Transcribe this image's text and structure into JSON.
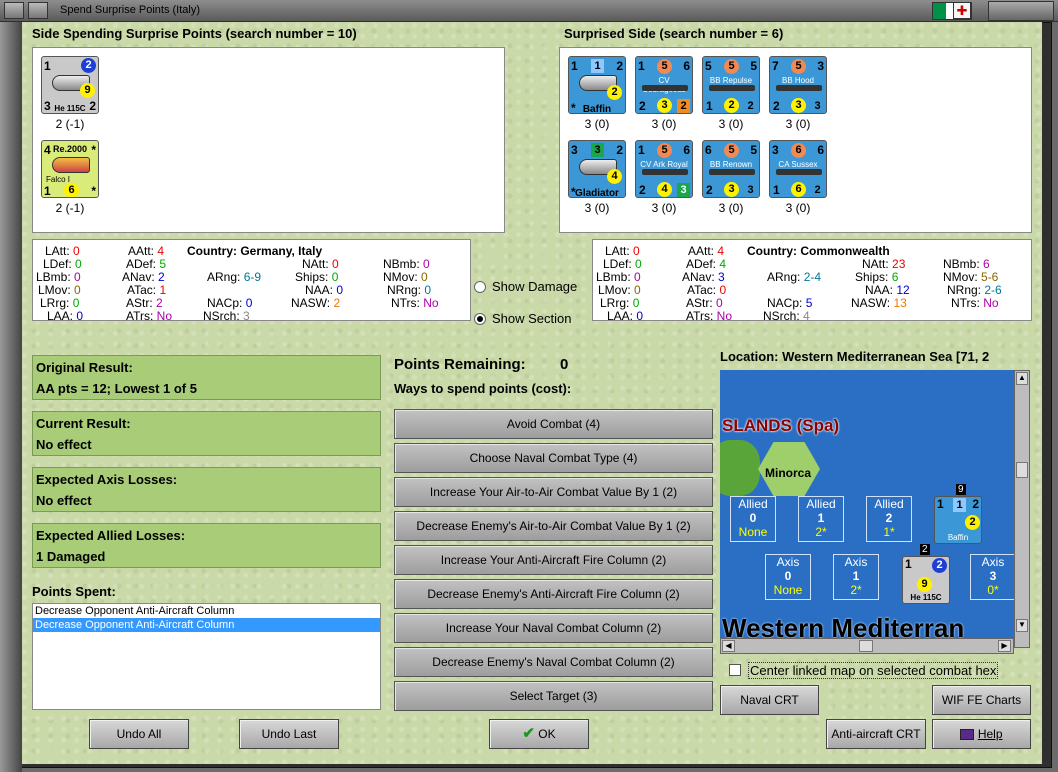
{
  "window": {
    "title": "Spend Surprise Points (Italy)"
  },
  "colors": {
    "flag_green": "#009246",
    "flag_white": "#ffffff",
    "flag_red": "#ce2b37",
    "panel_bg": "#cad9a8",
    "result_bg": "#a8cc78",
    "counter_blue": "#3b97d6",
    "sea": "#2a6fc4"
  },
  "spending": {
    "header": "Side Spending Surprise Points (search number = 10)",
    "units": [
      {
        "tl": "1",
        "tr": "2",
        "bl": "3",
        "br": "2",
        "mid": "9",
        "name": "He 115C",
        "caption": "2 (-1)",
        "icon": "seaplane-icon"
      },
      {
        "tl": "4",
        "tr": "*",
        "bl": "1",
        "bm": "6",
        "br": "*",
        "name_top": "Re.2000",
        "name": "Falco I",
        "caption": "2 (-1)",
        "icon": "fighter-icon"
      }
    ]
  },
  "surprised": {
    "header": "Surprised Side (search number = 6)",
    "units": [
      {
        "tl": "1",
        "tm": "1",
        "tr": "2",
        "mid": "2",
        "name": "Baffin",
        "bl": "*",
        "caption": "3 (0)"
      },
      {
        "tl": "1",
        "tm": "5",
        "tr": "6",
        "name": "CV Courageous",
        "bl": "2",
        "bm": "3",
        "br": "2",
        "caption": "3 (0)"
      },
      {
        "tl": "5",
        "tm": "5",
        "tr": "5",
        "name": "BB Repulse",
        "bl": "1",
        "bm": "2",
        "br": "2",
        "caption": "3 (0)"
      },
      {
        "tl": "7",
        "tm": "5",
        "tr": "3",
        "name": "BB Hood",
        "bl": "2",
        "bm": "3",
        "br": "3",
        "caption": "3 (0)"
      },
      {
        "tl": "3",
        "tm": "3",
        "tr": "2",
        "mid": "4",
        "name": "Gladiator",
        "bl": "*",
        "caption": "3 (0)"
      },
      {
        "tl": "1",
        "tm": "5",
        "tr": "6",
        "name": "CV Ark Royal",
        "bl": "2",
        "bm": "4",
        "br": "3",
        "caption": "3 (0)"
      },
      {
        "tl": "6",
        "tm": "5",
        "tr": "5",
        "name": "BB Renown",
        "bl": "2",
        "bm": "3",
        "br": "3",
        "caption": "3 (0)"
      },
      {
        "tl": "3",
        "tm": "6",
        "tr": "6",
        "name": "CA Sussex",
        "bl": "1",
        "bm": "6",
        "br": "2",
        "caption": "3 (0)"
      }
    ]
  },
  "axis_stats": {
    "country_label": "Country:",
    "country": "Germany, Italy",
    "LAtt": "0",
    "LDef": "0",
    "LBmb": "0",
    "LMov": "0",
    "LRrg": "0",
    "LAA": "0",
    "AAtt": "4",
    "ADef": "5",
    "ANav": "2",
    "ATac": "1",
    "AStr": "2",
    "ATrs": "No",
    "ARng": "6-9",
    "NACp": "0",
    "NSrch": "3",
    "NAtt": "0",
    "Ships": "0",
    "NAA": "0",
    "NASW": "2",
    "NBmb": "0",
    "NMov": "0",
    "NRng": "0",
    "NTrs": "No"
  },
  "allied_stats": {
    "country_label": "Country:",
    "country": "Commonwealth",
    "LAtt": "0",
    "LDef": "0",
    "LBmb": "0",
    "LMov": "0",
    "LRrg": "0",
    "LAA": "0",
    "AAtt": "4",
    "ADef": "4",
    "ANav": "3",
    "ATac": "0",
    "AStr": "0",
    "ATrs": "No",
    "ARng": "2-4",
    "NACp": "5",
    "NSrch": "4",
    "NAtt": "23",
    "Ships": "6",
    "NAA": "12",
    "NASW": "13",
    "NBmb": "6",
    "NMov": "5-6",
    "NRng": "2-6",
    "NTrs": "No"
  },
  "show": {
    "damage": "Show Damage",
    "section": "Show Section",
    "selected": "section"
  },
  "results": [
    {
      "title": "Original Result:",
      "value": "AA pts = 12; Lowest 1 of 5"
    },
    {
      "title": "Current Result:",
      "value": "No effect"
    },
    {
      "title": "Expected Axis Losses:",
      "value": "No effect"
    },
    {
      "title": "Expected Allied Losses:",
      "value": "1 Damaged"
    }
  ],
  "points_spent": {
    "label": "Points Spent:",
    "items": [
      "Decrease Opponent Anti-Aircraft Column",
      "Decrease Opponent Anti-Aircraft Column"
    ],
    "selected_index": 1
  },
  "remaining": {
    "label": "Points Remaining:",
    "value": "0",
    "ways": "Ways to spend points (cost):"
  },
  "actions": [
    "Avoid Combat (4)",
    "Choose Naval Combat Type (4)",
    "Increase Your Air-to-Air Combat Value By 1 (2)",
    "Decrease Enemy's Air-to-Air Combat Value By 1 (2)",
    "Increase Your Anti-Aircraft Fire Column (2)",
    "Decrease Enemy's Anti-Aircraft Fire Column (2)",
    "Increase Your Naval Combat Column (2)",
    "Decrease Enemy's Naval Combat Column (2)",
    "Select Target (3)"
  ],
  "location": {
    "label": "Location: Western Mediterranean Sea [71, 2"
  },
  "map": {
    "islands_label": "SLANDS (Spa)",
    "minorca": "Minorca",
    "sea_label": "Western Mediterran",
    "allied_boxes": [
      {
        "t": "Allied",
        "n": "0",
        "v": "None"
      },
      {
        "t": "Allied",
        "n": "1",
        "v": "2*"
      },
      {
        "t": "Allied",
        "n": "2",
        "v": "1*"
      }
    ],
    "axis_boxes": [
      {
        "t": "Axis",
        "n": "0",
        "v": "None"
      },
      {
        "t": "Axis",
        "n": "1",
        "v": "2*"
      },
      {
        "t": "Axis",
        "n": "3",
        "v": "0*"
      }
    ],
    "stack_allied": "9",
    "stack_axis": "2",
    "allied_counter": {
      "tl": "1",
      "tm": "1",
      "tr": "2",
      "mid": "2",
      "name": "Baffin"
    },
    "axis_counter": {
      "tl": "1",
      "tr": "2",
      "mid": "9",
      "name": "He 115C"
    }
  },
  "center_checkbox": "Center linked map on selected combat hex",
  "buttons": {
    "undo_all": "Undo All",
    "undo_last": "Undo Last",
    "ok": "OK",
    "naval_crt": "Naval CRT",
    "wif_fe_charts": "WIF FE Charts",
    "aa_crt": "Anti-aircraft CRT",
    "help": "Help"
  }
}
